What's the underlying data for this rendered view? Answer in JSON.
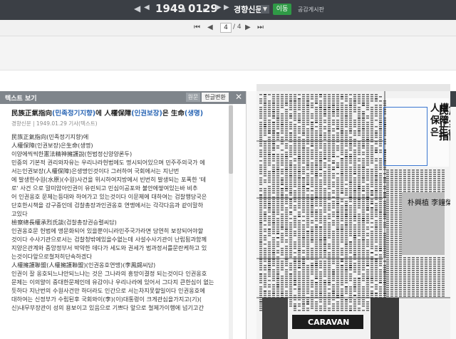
{
  "topbar": {
    "nav_left_1": "◀",
    "nav_left_2": "◀",
    "year": "1949",
    "month": "01",
    "day": "29",
    "nav_right_1": "▶",
    "nav_right_2": "▶",
    "newspaper": "경향신문",
    "go_label": "이동",
    "share_label": "공감게시판"
  },
  "pager": {
    "first": "⏮",
    "prev": "◀",
    "current": "4",
    "total": "/ 4",
    "next": "▶",
    "last": "⏭"
  },
  "panel": {
    "title": "텍스트 보기",
    "tab_original": "원문",
    "tab_korean": "한글변환",
    "close": "✕",
    "heading_prefix": "民族正氣指向",
    "heading_paren1": "(민족정기지향)",
    "heading_mid": "에 人權保障",
    "heading_paren2": "(인권보장)",
    "heading_mid2": "은 生命",
    "heading_paren3": "(생명)",
    "meta": "경향신문 | 1949.01.29 기사(텍스트)",
    "lines": [
      "民族正氣指向(민족정기지향)에",
      "人權保障(인권보장)은生命(생명)",
      "이양에씩씩한憲法精神擁護說(헌법정신양양론두)",
      "민중의 기본적 권리와자유는 우리나라헌법에도 명시되어있으며 민주주의국가 에",
      "서는인권보장(人權保障)은생명인것이다 그러하여 국회에서는 지난번",
      "에 발생한수원(水原)(수원)사건을 위시하여지방에서 빈번히 발생되는 포폭한 '테",
      "로' 사건 으로 말미암아인권이 유린되고 민심이공포와 불안에쌓여있는바 비추",
      "어 인권옹호 문제는등대와 하여가고 있는것이다 이문제에 대하여는 검찰행당국은",
      "단호한시책을 강구중인데 검찰총장과인권옹호 연맹에서는 각각다음과 같이말하",
      "고있다",
      "檢察總長權承烈氏談(검찰총장권승렬씨담)",
      "인권옹호문 헌법에 명문화되어 있을뿐이니라민주국가라면 당연히 보장되어야할",
      "것이다 수사기관으로서는 검찰청밖에있을수없는데 사설수사기관이 난립됨과함께",
      "지양은관계와 중앙정부서 박약한 데다가 세도와 권세가 법과정서를문란케하고 있",
      "는것이다앞으로철저히단속하겠다",
      "人權擁護聯盟(人權擁護聯盟)(인권옹호연맹)(李鳳錫씨담)",
      "인권이 잘 옹호되느냐안되느냐는 것은 그나라의 흥망이결정 되는것이다 인권옹호",
      "문제는 이의얄이 중대한문제인데 유감이나 우리나라에 있어서 그다지 큰한심이 없는",
      "듯하다 지난번의 수원사건만 하더라도 인간으로 서는차지못할일이다 인권옹호에",
      "대하여는 신정부가 수립된후 국회와이(李)(이)대통령이 크게관심을가지고(기)(",
      "신)내무부장관이 성의 용보이고 있음으로 기쁘다 앞으로 철제가이행에 넘기고간"
    ]
  },
  "viewer": {
    "headline": "民族正氣指向에 人權保障은生命",
    "caption_right": "朴興植 李鐘榮",
    "banner": "CARAVAN"
  },
  "colors": {
    "topbar": "#3b3f45",
    "go_button": "#2f9a46",
    "link_blue": "#2b67b5",
    "highlight_blue": "#3a76d0",
    "panel_header": "#7f858b"
  }
}
